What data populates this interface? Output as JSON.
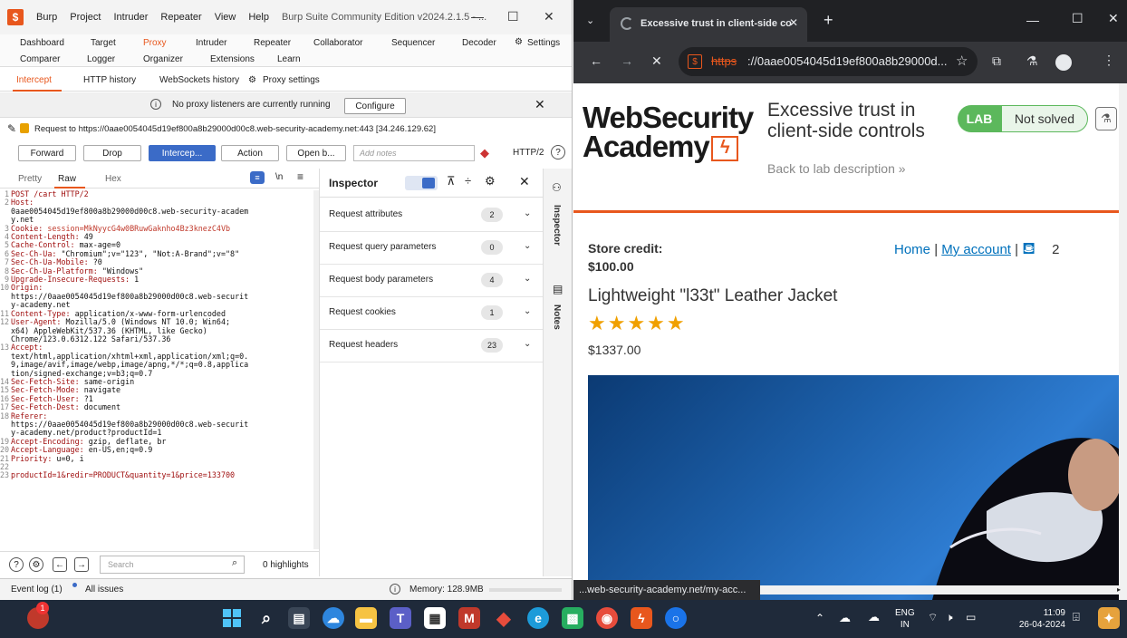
{
  "burp": {
    "menu": [
      "Burp",
      "Project",
      "Intruder",
      "Repeater",
      "View",
      "Help"
    ],
    "title": "Burp Suite Community Edition v2024.2.1.5 - ...",
    "tabs_row1": [
      "Dashboard",
      "Target",
      "Proxy",
      "Intruder",
      "Repeater",
      "Collaborator",
      "Sequencer",
      "Decoder",
      "Settings"
    ],
    "tabs_row2": [
      "Comparer",
      "Logger",
      "Organizer",
      "Extensions",
      "Learn"
    ],
    "subtabs": [
      "Intercept",
      "HTTP history",
      "WebSockets history",
      "Proxy settings"
    ],
    "notice": "No proxy listeners are currently running",
    "configure": "Configure",
    "request_to": "Request to https://0aae0054045d19ef800a8b29000d00c8.web-security-academy.net:443  [34.246.129.62]",
    "actions": {
      "forward": "Forward",
      "drop": "Drop",
      "intercept": "Intercep...",
      "action": "Action",
      "open": "Open b...",
      "notes_placeholder": "Add notes",
      "http": "HTTP/2"
    },
    "editor_tabs": [
      "Pretty",
      "Raw",
      "Hex"
    ],
    "editor_misc": "\\n",
    "editor_lines": [
      {
        "n": "1",
        "k": "POST /cart HTTP/2",
        "v": ""
      },
      {
        "n": "2",
        "k": "Host:",
        "v": ""
      },
      {
        "n": "",
        "k": "",
        "v": "0aae0054045d19ef800a8b29000d00c8.web-security-academ"
      },
      {
        "n": "",
        "k": "",
        "v": "y.net"
      },
      {
        "n": "3",
        "k": "Cookie: ",
        "v": "session=MkNyycG4w0BRuwGaknho4Bz3knezC4Vb"
      },
      {
        "n": "4",
        "k": "Content-Length: ",
        "v": "49"
      },
      {
        "n": "5",
        "k": "Cache-Control: ",
        "v": "max-age=0"
      },
      {
        "n": "6",
        "k": "Sec-Ch-Ua: ",
        "v": "\"Chromium\";v=\"123\", \"Not:A-Brand\";v=\"8\""
      },
      {
        "n": "7",
        "k": "Sec-Ch-Ua-Mobile: ",
        "v": "?0"
      },
      {
        "n": "8",
        "k": "Sec-Ch-Ua-Platform: ",
        "v": "\"Windows\""
      },
      {
        "n": "9",
        "k": "Upgrade-Insecure-Requests: ",
        "v": "1"
      },
      {
        "n": "10",
        "k": "Origin:",
        "v": ""
      },
      {
        "n": "",
        "k": "",
        "v": "https://0aae0054045d19ef800a8b29000d00c8.web-securit"
      },
      {
        "n": "",
        "k": "",
        "v": "y-academy.net"
      },
      {
        "n": "11",
        "k": "Content-Type: ",
        "v": "application/x-www-form-urlencoded"
      },
      {
        "n": "12",
        "k": "User-Agent: ",
        "v": "Mozilla/5.0 (Windows NT 10.0; Win64;"
      },
      {
        "n": "",
        "k": "",
        "v": "x64) AppleWebKit/537.36 (KHTML, like Gecko)"
      },
      {
        "n": "",
        "k": "",
        "v": "Chrome/123.0.6312.122 Safari/537.36"
      },
      {
        "n": "13",
        "k": "Accept:",
        "v": ""
      },
      {
        "n": "",
        "k": "",
        "v": "text/html,application/xhtml+xml,application/xml;q=0."
      },
      {
        "n": "",
        "k": "",
        "v": "9,image/avif,image/webp,image/apng,*/*;q=0.8,applica"
      },
      {
        "n": "",
        "k": "",
        "v": "tion/signed-exchange;v=b3;q=0.7"
      },
      {
        "n": "14",
        "k": "Sec-Fetch-Site: ",
        "v": "same-origin"
      },
      {
        "n": "15",
        "k": "Sec-Fetch-Mode: ",
        "v": "navigate"
      },
      {
        "n": "16",
        "k": "Sec-Fetch-User: ",
        "v": "?1"
      },
      {
        "n": "17",
        "k": "Sec-Fetch-Dest: ",
        "v": "document"
      },
      {
        "n": "18",
        "k": "Referer:",
        "v": ""
      },
      {
        "n": "",
        "k": "",
        "v": "https://0aae0054045d19ef800a8b29000d00c8.web-securit"
      },
      {
        "n": "",
        "k": "",
        "v": "y-academy.net/product?productId=1"
      },
      {
        "n": "19",
        "k": "Accept-Encoding: ",
        "v": "gzip, deflate, br"
      },
      {
        "n": "20",
        "k": "Accept-Language: ",
        "v": "en-US,en;q=0.9"
      },
      {
        "n": "21",
        "k": "Priority: ",
        "v": "u=0, i"
      },
      {
        "n": "22",
        "k": "",
        "v": ""
      },
      {
        "n": "23",
        "k": "productId=1&redir=PRODUCT&quantity=1&price=133700",
        "v": ""
      }
    ],
    "search_placeholder": "Search",
    "highlights": "0 highlights",
    "inspector": {
      "title": "Inspector",
      "rows": [
        {
          "label": "Request attributes",
          "count": "2"
        },
        {
          "label": "Request query parameters",
          "count": "0"
        },
        {
          "label": "Request body parameters",
          "count": "4"
        },
        {
          "label": "Request cookies",
          "count": "1"
        },
        {
          "label": "Request headers",
          "count": "23"
        }
      ]
    },
    "rail": [
      "Inspector",
      "Notes"
    ],
    "status": {
      "event_log": "Event log (1)",
      "all_issues": "All issues",
      "memory": "Memory: 128.9MB"
    }
  },
  "chrome": {
    "tab_title": "Excessive trust in client-side co",
    "url_scheme": "https",
    "url_rest": "://0aae0054045d19ef800a8b29000d...",
    "status_tip": "...web-security-academy.net/my-acc..."
  },
  "page": {
    "logo_line1": "WebSecurity",
    "logo_line2": "Academy",
    "lab_title_line1": "Excessive trust in",
    "lab_title_line2": "client-side controls",
    "lab_tag": "LAB",
    "lab_status": "Not solved",
    "back_link": "Back to lab description",
    "store_credit_label": "Store credit:",
    "store_credit_value": "$100.00",
    "nav_home": "Home",
    "nav_account": "My account",
    "cart_count": "2",
    "product_name": "Lightweight \"l33t\" Leather Jacket",
    "stars": "★★★★★",
    "price": "$1337.00"
  },
  "taskbar": {
    "lang1": "ENG",
    "lang2": "IN",
    "time": "11:09",
    "date": "26-04-2024",
    "badge": "1"
  }
}
